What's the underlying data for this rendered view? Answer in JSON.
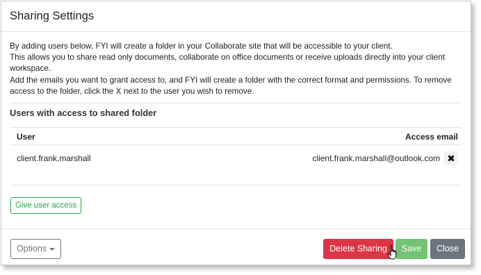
{
  "modal": {
    "title": "Sharing Settings",
    "intro": {
      "p1": "By adding users below, FYI will create a folder in your Collaborate site that will be accessible to your client.",
      "p2": "This allows you to share read only documents, collaborate on office documents or receive uploads directly into your client workspace.",
      "p3": "Add the emails you want to grant access to, and FYI will create a folder with the correct format and permissions. To remove access to the folder, click the X next to the user you wish to remove."
    },
    "section_title": "Users with access to shared folder",
    "table": {
      "headers": {
        "user": "User",
        "email": "Access email"
      },
      "rows": [
        {
          "user": "client.frank.marshall",
          "email": "client.frank.marshall@outlook.com",
          "remove": "✖"
        }
      ]
    },
    "give_access_label": "Give user access",
    "footer": {
      "options_label": "Options",
      "delete_label": "Delete Sharing",
      "save_label": "Save",
      "close_label": "Close"
    }
  },
  "colors": {
    "danger": "#dc3545",
    "success": "#5cb85c",
    "secondary": "#6c757d",
    "outline_success": "#28a745"
  },
  "icons": {
    "remove": "close-icon",
    "options_caret": "caret-down-icon",
    "cursor": "hand-pointer-icon"
  }
}
